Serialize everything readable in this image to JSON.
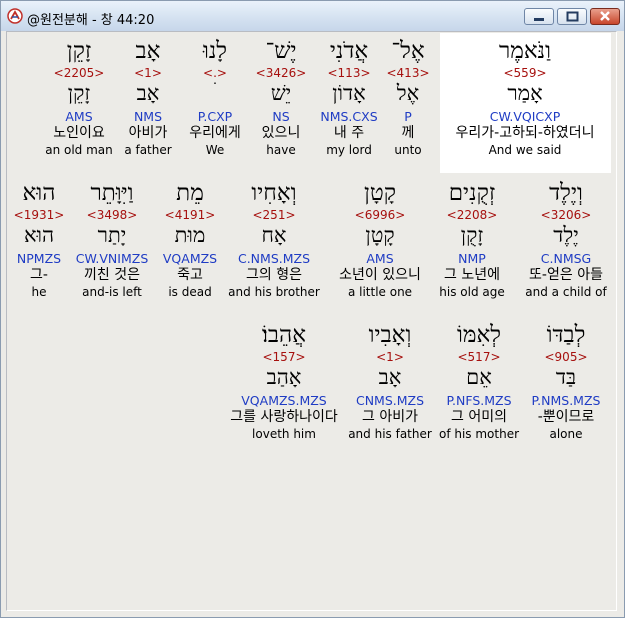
{
  "window": {
    "title": "@원전분해 - 창 44:20"
  },
  "lines": [
    [
      {
        "heb": "וַנֹּאמֶר",
        "strong": "<559>",
        "lex": "אָמַר",
        "pos": "CW.VQICXP",
        "ko": "우리가-고하되-하였더니",
        "en": "And we said",
        "selected": true
      },
      {
        "heb": "אֶל־",
        "strong": "<413>",
        "lex": "אֶל",
        "pos": "P",
        "ko": "께",
        "en": "unto"
      },
      {
        "heb": "אֲדֹנִי",
        "strong": "<113>",
        "lex": "אָדוֹן",
        "pos": "NMS.CXS",
        "ko": "내 주",
        "en": "my lord"
      },
      {
        "heb": "יֶשׁ־",
        "strong": "<3426>",
        "lex": "יֵשׁ",
        "pos": "NS",
        "ko": "있으니",
        "en": "have"
      },
      {
        "heb": "לָנוּ",
        "strong": "<.>",
        "lex": "ׄ",
        "pos": "P.CXP",
        "ko": "우리에게",
        "en": "We"
      },
      {
        "heb": "אָב",
        "strong": "<1>",
        "lex": "אָב",
        "pos": "NMS",
        "ko": "아비가",
        "en": "a father"
      },
      {
        "heb": "זָקֵן",
        "strong": "<2205>",
        "lex": "זָקֵן",
        "pos": "AMS",
        "ko": "노인이요",
        "en": "an old man"
      }
    ],
    [
      {
        "heb": "וְיֶלֶד",
        "strong": "<3206>",
        "lex": "יֶלֶד",
        "pos": "C.NMSG",
        "ko": "또-얻은 아들",
        "en": "and a child of"
      },
      {
        "heb": "זְקֻנִים",
        "strong": "<2208>",
        "lex": "זָקֻן",
        "pos": "NMP",
        "ko": "그 노년에",
        "en": "his old age"
      },
      {
        "heb": "קָטָן",
        "strong": "<6996>",
        "lex": "קָטָן",
        "pos": "AMS",
        "ko": "소년이 있으니",
        "en": "a little one"
      },
      {
        "heb": "וְאָחִיו",
        "strong": "<251>",
        "lex": "אָח",
        "pos": "C.NMS.MZS",
        "ko": "그의 형은",
        "en": "and his brother"
      },
      {
        "heb": "מֵת",
        "strong": "<4191>",
        "lex": "מוּת",
        "pos": "VQAMZS",
        "ko": "죽고",
        "en": "is dead"
      },
      {
        "heb": "וַיִּוָּתֵר",
        "strong": "<3498>",
        "lex": "יָתַר",
        "pos": "CW.VNIMZS",
        "ko": "끼친 것은",
        "en": "and-is left"
      },
      {
        "heb": "הוּא",
        "strong": "<1931>",
        "lex": "הוּא",
        "pos": "NPMZS",
        "ko": "그-",
        "en": "he"
      }
    ],
    [
      {
        "heb": "לְבַדּוֹ",
        "strong": "<905>",
        "lex": "בַּד",
        "pos": "P.NMS.MZS",
        "ko": "-뿐이므로",
        "en": "alone"
      },
      {
        "heb": "לְאִמּוֹ",
        "strong": "<517>",
        "lex": "אֵם",
        "pos": "P.NFS.MZS",
        "ko": "그 어미의",
        "en": "of his mother"
      },
      {
        "heb": "וְאָבִיו",
        "strong": "<1>",
        "lex": "אָב",
        "pos": "CNMS.MZS",
        "ko": "그 아비가",
        "en": "and his father"
      },
      {
        "heb": "אֲהֵבוֹ׃",
        "strong": "<157>",
        "lex": "אָהַב",
        "pos": "VQAMZS.MZS",
        "ko": "그를 사랑하나이다",
        "en": "loveth him"
      }
    ]
  ]
}
